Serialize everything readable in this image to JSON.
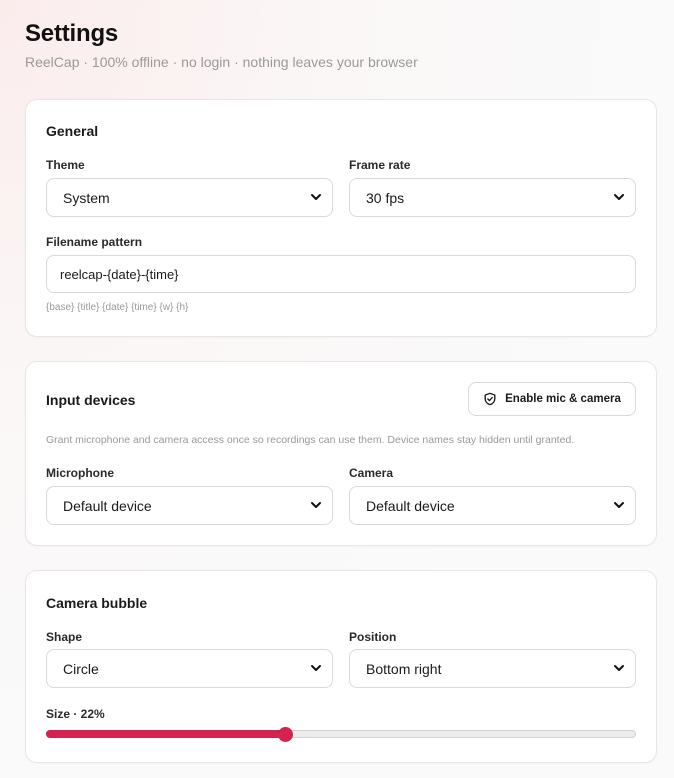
{
  "header": {
    "title": "Settings",
    "subtitle": "ReelCap · 100% offline · no login · nothing leaves your browser"
  },
  "general": {
    "title": "General",
    "theme": {
      "label": "Theme",
      "value": "System"
    },
    "frame_rate": {
      "label": "Frame rate",
      "value": "30 fps"
    },
    "filename": {
      "label": "Filename pattern",
      "value": "reelcap-{date}-{time}",
      "hint": "{base} {title} {date} {time} {w} {h}"
    }
  },
  "input_devices": {
    "title": "Input devices",
    "enable_button": {
      "label": "Enable mic & camera",
      "icon": "shield-check-icon"
    },
    "description": "Grant microphone and camera access once so recordings can use them. Device names stay hidden until granted.",
    "microphone": {
      "label": "Microphone",
      "value": "Default device"
    },
    "camera": {
      "label": "Camera",
      "value": "Default device"
    }
  },
  "camera_bubble": {
    "title": "Camera bubble",
    "shape": {
      "label": "Shape",
      "value": "Circle"
    },
    "position": {
      "label": "Position",
      "value": "Bottom right"
    },
    "size": {
      "label": "Size · 22%",
      "value_percent": 22,
      "slider_fraction": 0.405
    }
  },
  "colors": {
    "accent": "#d4234f",
    "border": "#d9d9d9",
    "muted_text": "#9a9a9a"
  }
}
